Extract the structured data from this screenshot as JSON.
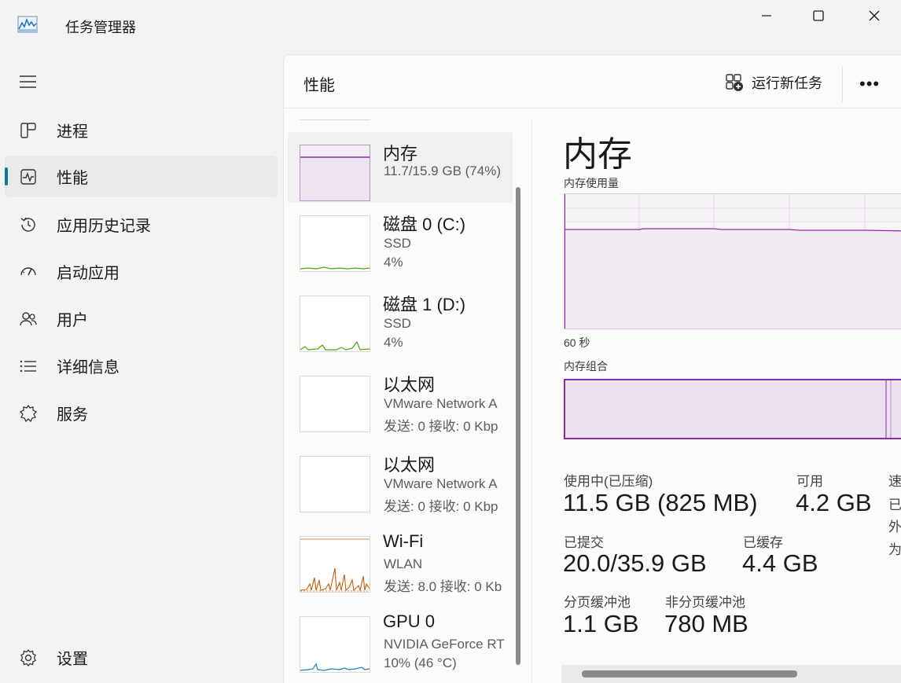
{
  "window": {
    "title": "任务管理器"
  },
  "sidebar": {
    "items": [
      {
        "label": "进程",
        "icon": "processes-icon"
      },
      {
        "label": "性能",
        "icon": "performance-icon",
        "active": true
      },
      {
        "label": "应用历史记录",
        "icon": "app-history-icon"
      },
      {
        "label": "启动应用",
        "icon": "startup-apps-icon"
      },
      {
        "label": "用户",
        "icon": "users-icon"
      },
      {
        "label": "详细信息",
        "icon": "details-icon"
      },
      {
        "label": "服务",
        "icon": "services-icon"
      }
    ],
    "settings_label": "设置"
  },
  "header": {
    "title": "性能",
    "run_task": "运行新任务"
  },
  "devices": [
    {
      "name": "内存",
      "line1": "11.7/15.9 GB (74%)",
      "line2": "",
      "active": true,
      "color": "#8e2aa3"
    },
    {
      "name": "磁盘 0 (C:)",
      "line1": "SSD",
      "line2": "4%",
      "color": "#4da60c"
    },
    {
      "name": "磁盘 1 (D:)",
      "line1": "SSD",
      "line2": "4%",
      "color": "#4da60c"
    },
    {
      "name": "以太网",
      "line1": "VMware Network A",
      "line2": "发送: 0 接收: 0 Kbp",
      "color": "#a74f01"
    },
    {
      "name": "以太网",
      "line1": "VMware Network A",
      "line2": "发送: 0 接收: 0 Kbp",
      "color": "#a74f01"
    },
    {
      "name": "Wi-Fi",
      "line1": "WLAN",
      "line2": "发送: 8.0 接收: 0 Kb",
      "color": "#c65d0b"
    },
    {
      "name": "GPU 0",
      "line1": "NVIDIA GeForce RT",
      "line2": "10% (46 °C)",
      "color": "#1c7fc2"
    }
  ],
  "detail": {
    "title": "内存",
    "usage_label": "内存使用量",
    "time_label": "60 秒",
    "composition_label": "内存组合",
    "stats": {
      "in_use_label": "使用中(已压缩)",
      "in_use_value": "11.5 GB (825 MB)",
      "available_label": "可用",
      "available_value": "4.2 GB",
      "speed_label_partial": "速",
      "speed_side_1": "已",
      "speed_side_2": "外",
      "speed_side_3": "为",
      "committed_label": "已提交",
      "committed_value": "20.0/35.9 GB",
      "cached_label": "已缓存",
      "cached_value": "4.4 GB",
      "paged_label": "分页缓冲池",
      "paged_value": "1.1 GB",
      "nonpaged_label": "非分页缓冲池",
      "nonpaged_value": "780 MB"
    }
  },
  "colors": {
    "accent": "#0f7b8b",
    "memory": "#8e2aa3",
    "disk": "#4da60c",
    "network": "#c65d0b",
    "gpu": "#1c7fc2"
  }
}
